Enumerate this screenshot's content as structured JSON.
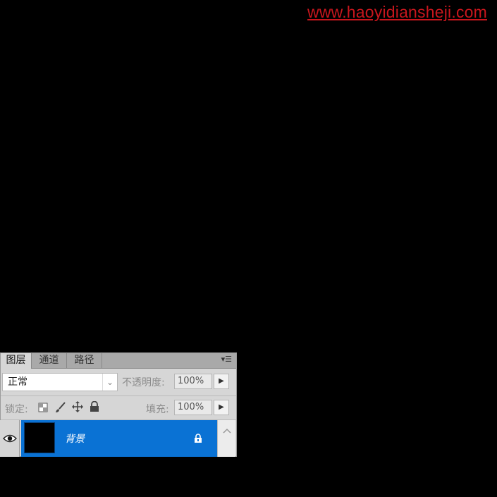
{
  "watermark": "www.haoyidiansheji.com",
  "panel": {
    "tabs": [
      {
        "label": "图层",
        "active": true
      },
      {
        "label": "通道",
        "active": false
      },
      {
        "label": "路径",
        "active": false
      }
    ],
    "menu_icon": "panel-menu-icon",
    "blend_mode": "正常",
    "opacity_label": "不透明度:",
    "opacity_value": "100%",
    "lock_label": "锁定:",
    "lock_icons": [
      "lock-transparent-icon",
      "lock-paint-icon",
      "lock-position-icon",
      "lock-all-icon"
    ],
    "fill_label": "填充:",
    "fill_value": "100%"
  },
  "layers": [
    {
      "name": "背景",
      "visible": true,
      "locked": true,
      "selected": true
    }
  ],
  "colors": {
    "selection": "#0a72d4",
    "watermark": "#c8161d"
  }
}
